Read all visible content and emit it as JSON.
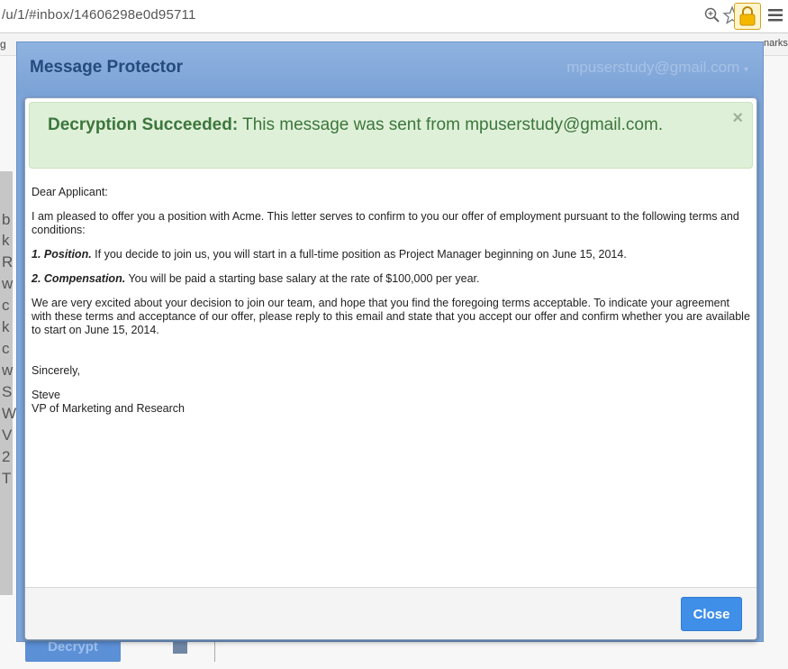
{
  "browser": {
    "url": "/u/1/#inbox/14606298e0d95711",
    "bookmarks_left": "g",
    "bookmarks_right": "narks"
  },
  "background_page": {
    "gutter_letters": [
      "b",
      "k",
      "R",
      "w",
      "c",
      "k",
      "c",
      "w",
      "S",
      "W",
      "V",
      "2",
      "T"
    ],
    "decrypt_button_label": "Decrypt"
  },
  "app": {
    "title": "Message Protector",
    "account": "mpuserstudy@gmail.com",
    "account_caret": "▾"
  },
  "alert": {
    "strong": "Decryption Succeeded:",
    "message": "This message was sent from mpuserstudy@gmail.com.",
    "close_glyph": "×"
  },
  "letter": {
    "greeting": "Dear Applicant:",
    "intro": "I am pleased to offer you a position with Acme. This letter serves to confirm to you our offer of employment pursuant to the following terms and conditions:",
    "item1_label": "1. Position.",
    "item1_text": "If you decide to join us, you will start in a full-time position as Project Manager beginning on June 15, 2014.",
    "item2_label": "2. Compensation.",
    "item2_text": "You will be paid a starting base salary at the rate of $100,000 per year.",
    "closing_para": "We are very excited about your decision to join our team, and hope that you find the foregoing terms acceptable. To indicate your agreement with these terms and acceptance of our offer, please reply to this email and state that you accept our offer and confirm whether you are available to start on June 15, 2014.",
    "signoff": "Sincerely,",
    "signer_name": "Steve",
    "signer_title": "VP of Marketing and Research"
  },
  "footer": {
    "close_label": "Close"
  },
  "colors": {
    "accent": "#3f8ee7",
    "success_bg": "#dff0d8",
    "success_text": "#3c763d",
    "overlay_blue": "#7da5d8"
  }
}
